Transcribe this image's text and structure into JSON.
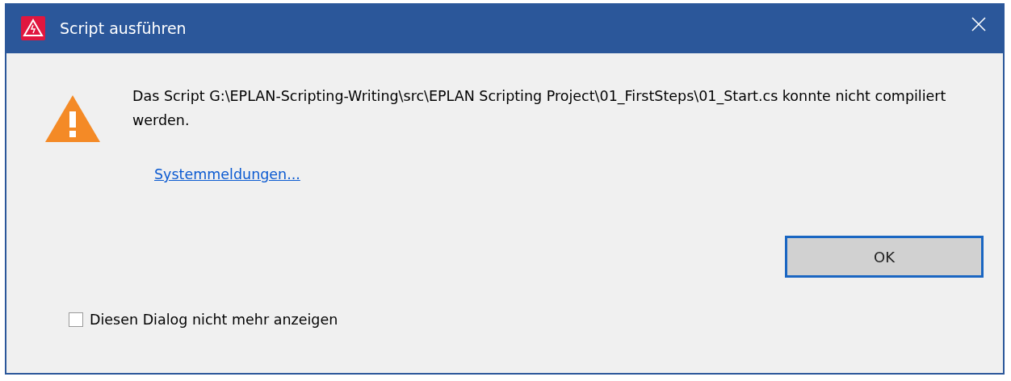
{
  "window": {
    "title": "Script ausführen"
  },
  "message": "Das Script G:\\EPLAN-Scripting-Writing\\src\\EPLAN Scripting Project\\01_FirstSteps\\01_Start.cs konnte nicht compiliert werden.",
  "link": "Systemmeldungen...",
  "buttons": [
    {
      "label": "OK",
      "selected": true
    }
  ],
  "checkbox": {
    "label": "Diesen Dialog nicht mehr anzeigen",
    "checked": false
  }
}
